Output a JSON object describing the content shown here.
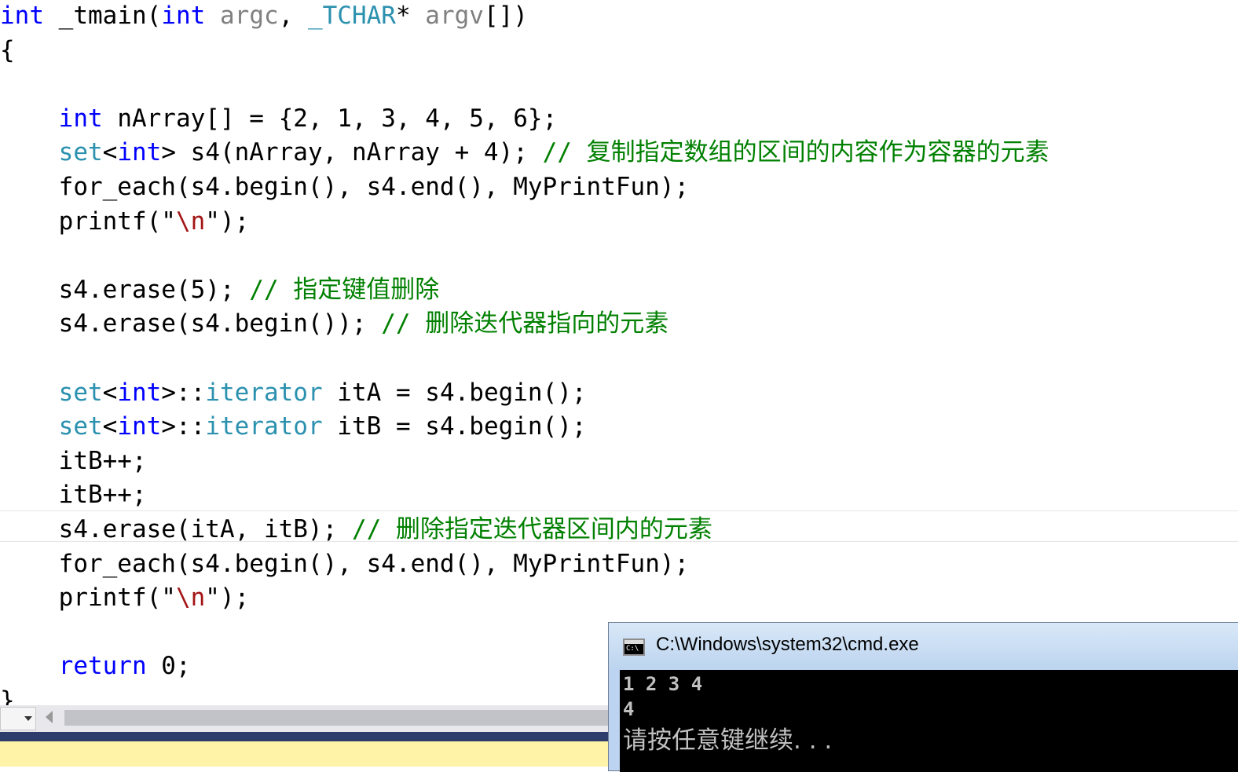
{
  "colors": {
    "keyword": "#0000ff",
    "type": "#2b91af",
    "comment": "#008000",
    "escape": "#a31515",
    "param": "#808080",
    "text": "#000000"
  },
  "code_lines": [
    [
      {
        "t": "int",
        "k": "keyword"
      },
      {
        "t": " "
      },
      {
        "t": "_tmain",
        "k": "text"
      },
      {
        "t": "("
      },
      {
        "t": "int",
        "k": "keyword"
      },
      {
        "t": " "
      },
      {
        "t": "argc",
        "k": "param"
      },
      {
        "t": ", "
      },
      {
        "t": "_TCHAR",
        "k": "type"
      },
      {
        "t": "* "
      },
      {
        "t": "argv",
        "k": "param"
      },
      {
        "t": "[])"
      }
    ],
    [
      {
        "t": "{"
      }
    ],
    [],
    [
      {
        "t": "    "
      },
      {
        "t": "int",
        "k": "keyword"
      },
      {
        "t": " nArray[] = {2, 1, 3, 4, 5, 6};"
      }
    ],
    [
      {
        "t": "    "
      },
      {
        "t": "set",
        "k": "type"
      },
      {
        "t": "<"
      },
      {
        "t": "int",
        "k": "keyword"
      },
      {
        "t": "> s4(nArray, nArray + 4); "
      },
      {
        "t": "// 复制指定数组的区间的内容作为容器的元素",
        "k": "comment"
      }
    ],
    [
      {
        "t": "    for_each(s4.begin(), s4.end(), MyPrintFun);"
      }
    ],
    [
      {
        "t": "    printf(\""
      },
      {
        "t": "\\n",
        "k": "escape"
      },
      {
        "t": "\");"
      }
    ],
    [],
    [
      {
        "t": "    s4.erase(5); "
      },
      {
        "t": "// 指定键值删除",
        "k": "comment"
      }
    ],
    [
      {
        "t": "    s4.erase(s4.begin()); "
      },
      {
        "t": "// 删除迭代器指向的元素",
        "k": "comment"
      }
    ],
    [],
    [
      {
        "t": "    "
      },
      {
        "t": "set",
        "k": "type"
      },
      {
        "t": "<"
      },
      {
        "t": "int",
        "k": "keyword"
      },
      {
        "t": ">::"
      },
      {
        "t": "iterator",
        "k": "type"
      },
      {
        "t": " itA = s4.begin();"
      }
    ],
    [
      {
        "t": "    "
      },
      {
        "t": "set",
        "k": "type"
      },
      {
        "t": "<"
      },
      {
        "t": "int",
        "k": "keyword"
      },
      {
        "t": ">::"
      },
      {
        "t": "iterator",
        "k": "type"
      },
      {
        "t": " itB = s4.begin();"
      }
    ],
    [
      {
        "t": "    itB++;"
      }
    ],
    [
      {
        "t": "    itB++;"
      }
    ],
    [
      {
        "t": "    s4.erase(itA, itB); "
      },
      {
        "t": "// 删除指定迭代器区间内的元素",
        "k": "comment"
      }
    ],
    [
      {
        "t": "    for_each(s4.begin(), s4.end(), MyPrintFun);"
      }
    ],
    [
      {
        "t": "    printf(\""
      },
      {
        "t": "\\n",
        "k": "escape"
      },
      {
        "t": "\");"
      }
    ],
    [],
    [
      {
        "t": "    "
      },
      {
        "t": "return",
        "k": "keyword"
      },
      {
        "t": " 0;"
      }
    ],
    [
      {
        "t": "}"
      }
    ]
  ],
  "cmd": {
    "title": "C:\\Windows\\system32\\cmd.exe",
    "icon_label": "C:\\",
    "output_line_1": "1 2 3 4",
    "output_line_2": "4",
    "output_line_3": "请按任意键继续. . ."
  }
}
